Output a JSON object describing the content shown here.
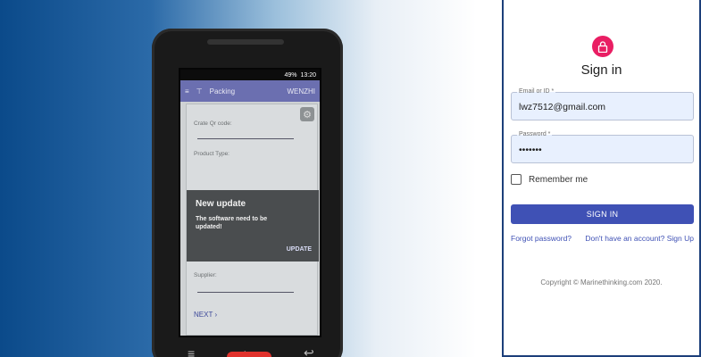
{
  "hero": {
    "device": {
      "status_battery": "49%",
      "status_time": "13:20",
      "app_title": "Packing",
      "app_user": "WENZHI",
      "field_qr_label": "Crate Qr code:",
      "field_product_label": "Product Type:",
      "field_supplier_label": "Supplier:",
      "modal_title": "New update",
      "modal_body": "The software need to be updated!",
      "modal_action": "UPDATE",
      "next_label": "NEXT"
    }
  },
  "signin": {
    "title": "Sign in",
    "email": {
      "label": "Email or ID *",
      "value": "lwz7512@gmail.com"
    },
    "password": {
      "label": "Password *",
      "value": "•••••••"
    },
    "remember_label": "Remember me",
    "submit_label": "SIGN IN",
    "forgot_label": "Forgot password?",
    "signup_label": "Don't have an account? Sign Up",
    "copyright": "Copyright © Marinethinking.com 2020."
  },
  "colors": {
    "accent": "#3f51b5",
    "lock_icon_bg": "#e91e63",
    "panel_border": "#1c3f7a"
  },
  "icons": [
    "lock-icon",
    "menu-icon",
    "gear-icon",
    "chevron-right-icon",
    "home-icon",
    "back-icon"
  ]
}
